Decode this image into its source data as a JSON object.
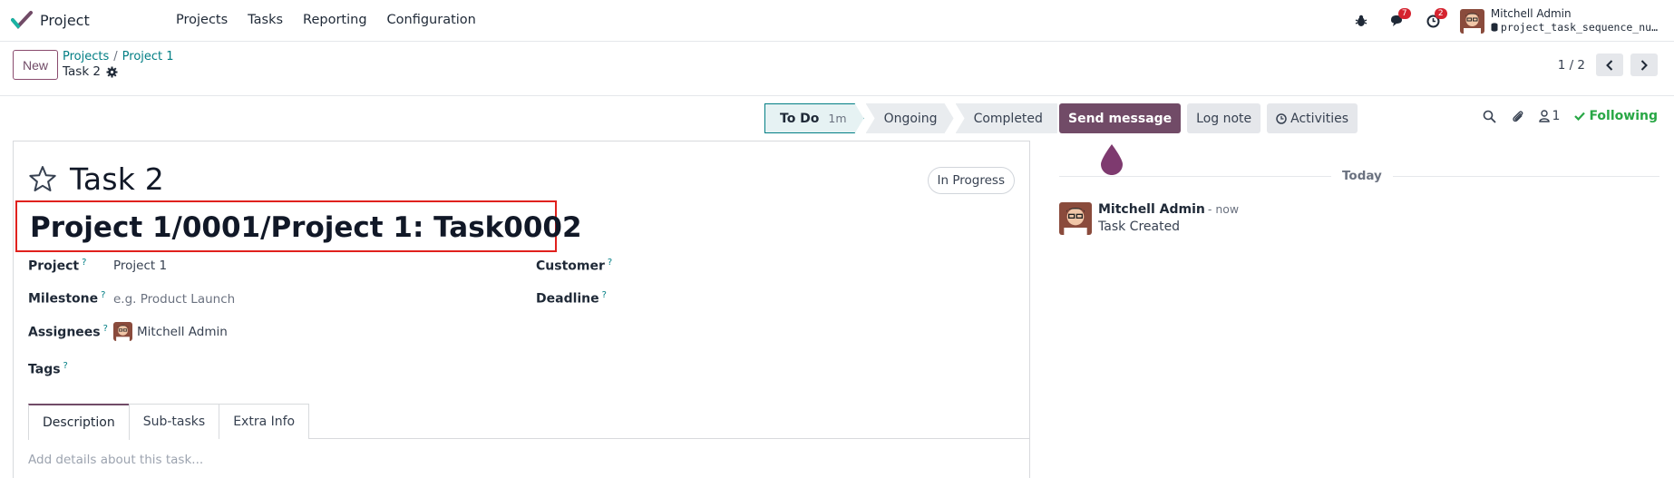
{
  "app": {
    "name": "Project"
  },
  "nav": {
    "menu": [
      "Projects",
      "Tasks",
      "Reporting",
      "Configuration"
    ]
  },
  "systray": {
    "messages_count": "7",
    "activities_count": "2",
    "user_name": "Mitchell Admin",
    "database": "project_task_sequence_nu…"
  },
  "control": {
    "new_label": "New",
    "breadcrumb": [
      "Projects",
      "Project 1"
    ],
    "current": "Task 2",
    "pager": "1 / 2"
  },
  "statusbar": {
    "stages": [
      {
        "label": "To Do",
        "duration": "1m"
      },
      {
        "label": "Ongoing"
      },
      {
        "label": "Completed"
      }
    ]
  },
  "form": {
    "title": "Task 2",
    "state": "In Progress",
    "sequence_name": "Project 1/0001/Project 1: Task0002",
    "fields": {
      "project_label": "Project",
      "project_value": "Project 1",
      "milestone_label": "Milestone",
      "milestone_placeholder": "e.g. Product Launch",
      "assignees_label": "Assignees",
      "assignee_value": "Mitchell Admin",
      "tags_label": "Tags",
      "customer_label": "Customer",
      "deadline_label": "Deadline",
      "help_mark": "?"
    },
    "tabs": [
      "Description",
      "Sub-tasks",
      "Extra Info"
    ],
    "description_placeholder": "Add details about this task..."
  },
  "chatter": {
    "send_message": "Send message",
    "log_note": "Log note",
    "activities": "Activities",
    "followers_count": "1",
    "following": "Following",
    "date_separator": "Today",
    "message": {
      "author": "Mitchell Admin",
      "time": "- now",
      "body": "Task Created"
    }
  },
  "colors": {
    "brand": "#714b67",
    "link": "#017e84",
    "following": "#28a745",
    "highlight_border": "#e0211d",
    "badge": "#d5232f"
  }
}
